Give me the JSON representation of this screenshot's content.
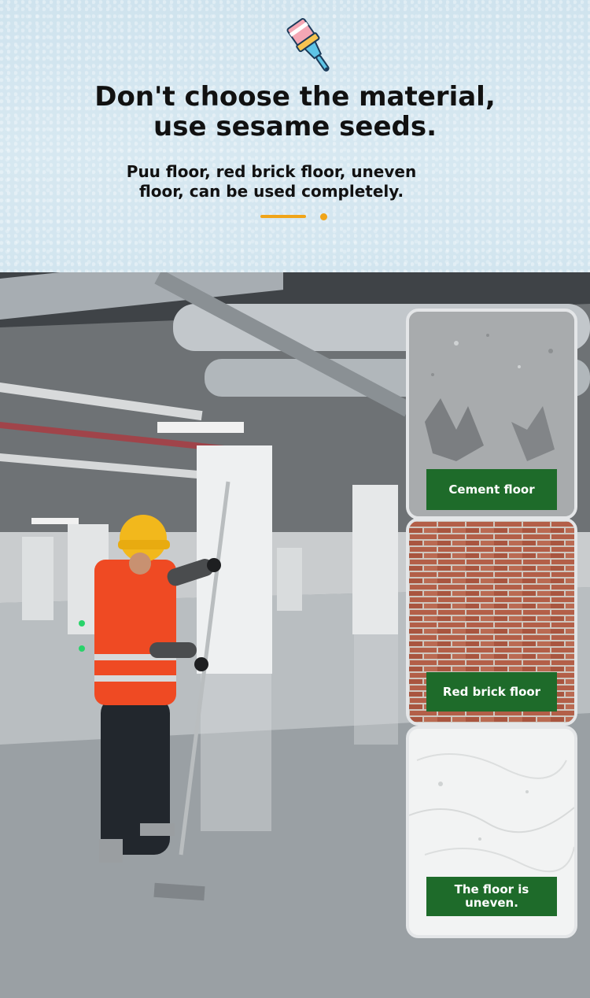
{
  "header": {
    "icon": "paint-brush-icon",
    "title_line1": "Don't choose the material,",
    "title_line2": "use sesame seeds.",
    "subtitle": "Puu floor, red brick floor, uneven floor, can be used completely.",
    "accent_color": "#f0a418"
  },
  "swatches": [
    {
      "label": "Cement floor"
    },
    {
      "label": "Red brick floor"
    },
    {
      "label": "The floor is uneven."
    }
  ],
  "colors": {
    "label_bg": "#1e6b2a",
    "label_text": "#ffffff"
  }
}
